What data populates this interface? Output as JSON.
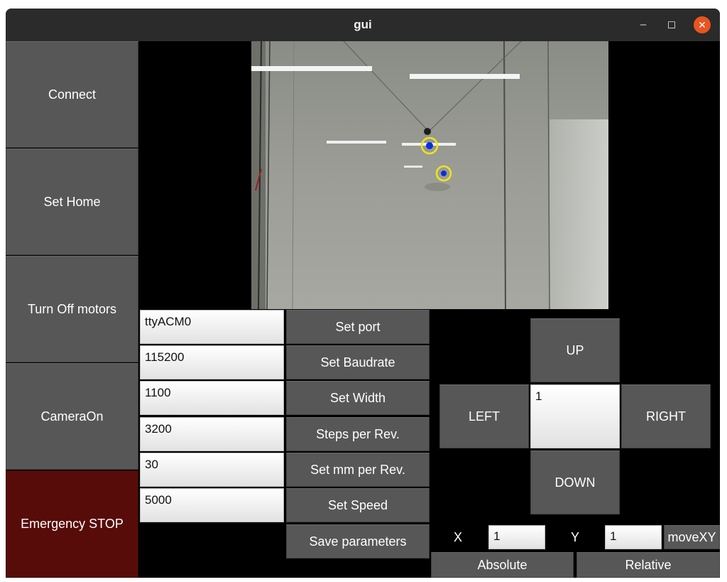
{
  "window": {
    "title": "gui",
    "minimize_icon": "minimize-icon",
    "maximize_icon": "maximize-icon",
    "close_icon": "close-icon",
    "close_color": "#e95420"
  },
  "sidebar": {
    "connect": "Connect",
    "set_home": "Set Home",
    "turn_off_motors": "Turn Off motors",
    "camera_on": "CameraOn",
    "emergency_stop": "Emergency STOP"
  },
  "parameters": [
    {
      "value": "ttyACM0",
      "button": "Set port"
    },
    {
      "value": "115200",
      "button": "Set Baudrate"
    },
    {
      "value": "1100",
      "button": "Set Width"
    },
    {
      "value": "3200",
      "button": "Steps per Rev."
    },
    {
      "value": "30",
      "button": "Set mm per Rev."
    },
    {
      "value": "5000",
      "button": "Set Speed"
    }
  ],
  "save_parameters": "Save parameters",
  "jog": {
    "up": "UP",
    "down": "DOWN",
    "left": "LEFT",
    "right": "RIGHT",
    "step": "1"
  },
  "move": {
    "x_label": "X",
    "x_value": "1",
    "y_label": "Y",
    "y_value": "1",
    "move_button": "moveXY",
    "absolute": "Absolute",
    "relative": "Relative"
  },
  "colors": {
    "button": "#575757",
    "emergency": "#570c0a",
    "background": "#000000",
    "marker_ring": "#f2e31a",
    "marker_dot": "#0a2fd6"
  }
}
